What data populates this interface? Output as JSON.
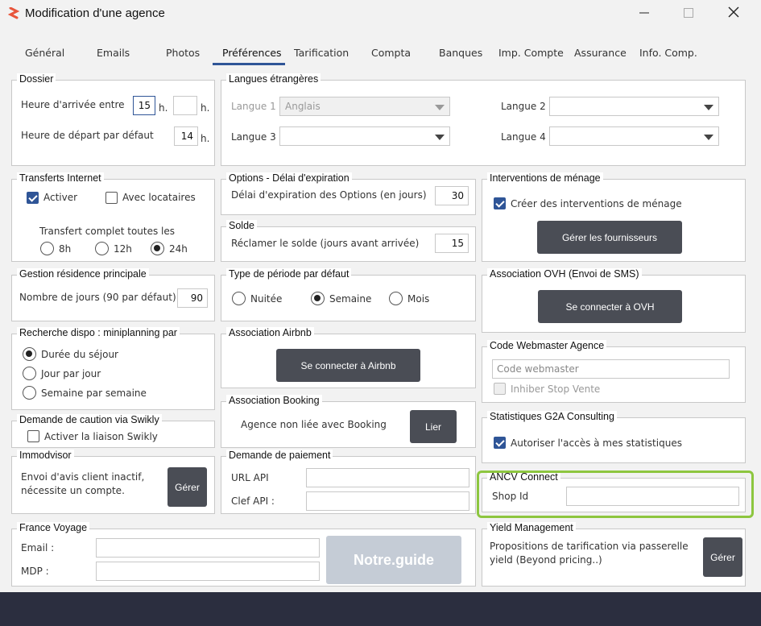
{
  "window": {
    "title": "Modification d'une agence"
  },
  "tabs": [
    "Général",
    "Emails",
    "Photos",
    "Préférences",
    "Tarification",
    "Compta",
    "Banques",
    "Imp. Compte",
    "Assurance",
    "Info. Comp."
  ],
  "dossier": {
    "title": "Dossier",
    "arrival_label": "Heure d'arrivée entre",
    "arrival_from": "15",
    "h1": "h.",
    "arrival_to": "",
    "h2": "h.",
    "departure_label": "Heure de départ par défaut",
    "departure_value": "14",
    "h3": "h."
  },
  "langues": {
    "title": "Langues étrangères",
    "langue1_label": "Langue 1",
    "langue1_value": "Anglais",
    "langue2_label": "Langue 2",
    "langue2_value": "",
    "langue3_label": "Langue 3",
    "langue3_value": "",
    "langue4_label": "Langue 4",
    "langue4_value": ""
  },
  "transferts": {
    "title": "Transferts Internet",
    "activer": "Activer",
    "avec_locataires": "Avec locataires",
    "complet_label": "Transfert complet toutes les",
    "opt_8h": "8h",
    "opt_12h": "12h",
    "opt_24h": "24h"
  },
  "options": {
    "title": "Options  -  Délai d'expiration",
    "delai_label": "Délai d'expiration des Options (en jours)",
    "delai_value": "30"
  },
  "solde": {
    "title": "Solde",
    "label": "Réclamer le solde (jours avant arrivée)",
    "value": "15"
  },
  "menage": {
    "title": "Interventions de ménage",
    "creer": "Créer des interventions de ménage",
    "btn": "Gérer les fournisseurs"
  },
  "gestion": {
    "title": "Gestion résidence principale",
    "label": "Nombre de jours (90 par défaut)",
    "value": "90"
  },
  "periode": {
    "title": "Type de période par défaut",
    "nuitee": "Nuitée",
    "semaine": "Semaine",
    "mois": "Mois"
  },
  "ovh": {
    "title": "Association OVH (Envoi de SMS)",
    "btn": "Se connecter à OVH"
  },
  "recherche": {
    "title": "Recherche dispo : miniplanning par",
    "duree": "Durée du séjour",
    "jour": "Jour par jour",
    "semaine": "Semaine par semaine"
  },
  "airbnb": {
    "title": "Association Airbnb",
    "btn": "Se connecter à Airbnb"
  },
  "webmaster": {
    "title": "Code Webmaster Agence",
    "placeholder": "Code webmaster",
    "inhiber": "Inhiber Stop Vente"
  },
  "booking": {
    "title": "Association Booking",
    "status": "Agence non liée avec Booking",
    "btn": "Lier"
  },
  "swikly": {
    "title": "Demande de caution via Swikly",
    "activer": "Activer la liaison Swikly"
  },
  "stats": {
    "title": "Statistiques G2A Consulting",
    "autoriser": "Autoriser l'accès à mes statistiques"
  },
  "immodvisor": {
    "title": "Immodvisor",
    "text1": "Envoi d'avis client inactif,",
    "text2": "nécessite un compte.",
    "btn": "Gérer"
  },
  "paiement": {
    "title": "Demande de paiement",
    "url_label": "URL API",
    "clef_label": "Clef API :"
  },
  "ancv": {
    "title": "ANCV Connect",
    "shop_label": "Shop Id"
  },
  "france": {
    "title": "France Voyage",
    "email_label": "Email :",
    "mdp_label": "MDP :",
    "btn": "Notre.guide"
  },
  "yield": {
    "title": "Yield Management",
    "text1": "Propositions de tarification via passerelle",
    "text2": "yield (Beyond pricing..)",
    "btn": "Gérer"
  },
  "colors": {
    "accent": "#2f5597",
    "highlight": "#8dc63f",
    "button": "#4a4d55"
  }
}
